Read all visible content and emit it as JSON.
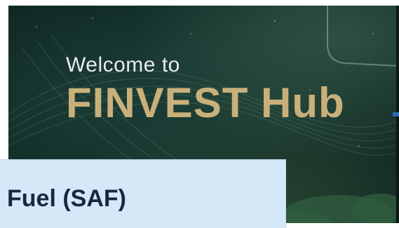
{
  "hero": {
    "welcome_text": "Welcome to",
    "brand_text": "FINVEST Hub"
  },
  "caption": {
    "text": "Fuel (SAF)"
  },
  "colors": {
    "background_dark": "#12302b",
    "brand_gold": "#c9b07a",
    "welcome_white": "#e9ecec",
    "caption_bg": "#d5e8f7",
    "caption_text": "#1b2540",
    "accent_blue": "#2a6bb8"
  }
}
